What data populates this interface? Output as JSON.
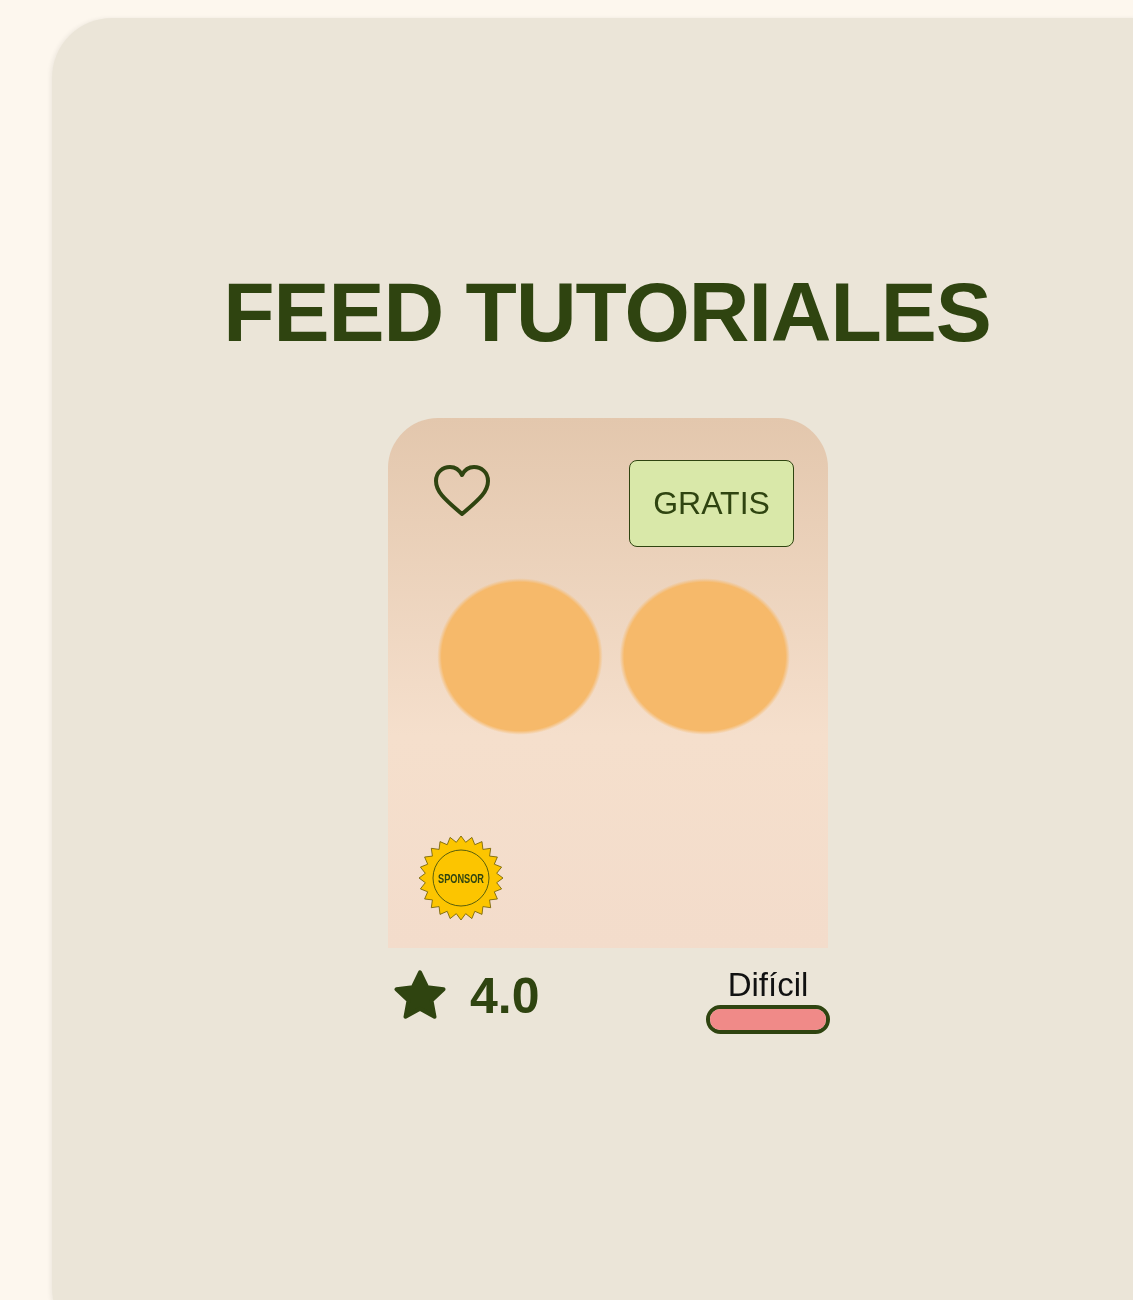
{
  "title": "FEED TUTORIALES",
  "tutorials": [
    {
      "badge": "GRATIS",
      "favorite": false,
      "sponsor_badge": "SPONSOR",
      "rating": "4.0",
      "difficulty": {
        "label": "Difícil",
        "level": 1
      }
    }
  ]
}
